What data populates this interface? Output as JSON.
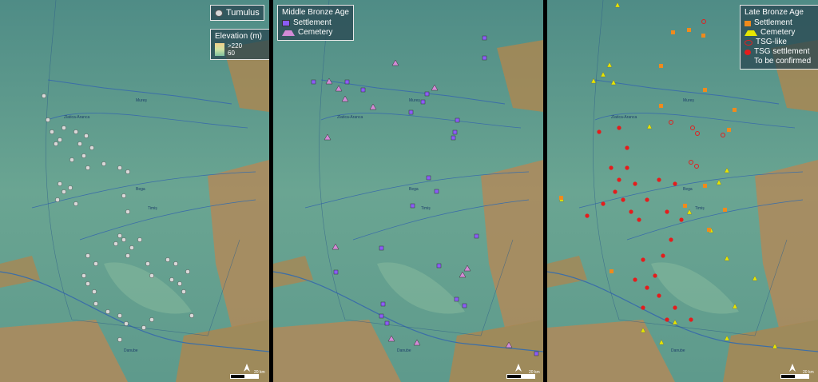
{
  "panels": [
    {
      "legend": {
        "title": "",
        "items": [
          {
            "label": "Tumulus",
            "symbol": "grey-circle"
          }
        ],
        "elevation_title": "Elevation (m)",
        "elevation_high": ">220",
        "elevation_low": "60"
      },
      "rivers": [
        "Mureș",
        "Zlatica-Aranca",
        "Bega",
        "Timiș",
        "Danube"
      ],
      "scale_label": "20 km"
    },
    {
      "legend": {
        "title": "Middle Bronze Age",
        "items": [
          {
            "label": "Settlement",
            "symbol": "purple-square"
          },
          {
            "label": "Cemetery",
            "symbol": "purple-triangle"
          }
        ]
      },
      "rivers": [
        "Mureș",
        "Zlatica-Aranca",
        "Bega",
        "Timiș",
        "Danube"
      ],
      "scale_label": "20 km"
    },
    {
      "legend": {
        "title": "Late Bronze Age",
        "items": [
          {
            "label": "Settlement",
            "symbol": "orange-square"
          },
          {
            "label": "Cemetery",
            "symbol": "yellow-triangle"
          },
          {
            "label": "TSG-like",
            "symbol": "red-ring"
          },
          {
            "label": "TSG settlement",
            "symbol": "red-dot"
          },
          {
            "label": "To be confirmed",
            "symbol": "none"
          }
        ]
      },
      "rivers": [
        "Mureș",
        "Zlatica-Aranca",
        "Bega",
        "Timiș",
        "Danube"
      ],
      "scale_label": "20 km"
    }
  ],
  "colors": {
    "tumulus": "#d8d8d8",
    "mba_settlement": "#8b5cf6",
    "mba_cemetery": "#d38bd6",
    "lba_settlement": "#f08a1c",
    "lba_cemetery": "#e6e600",
    "tsg": "#e51c1c",
    "river": "#3b6ea8",
    "lowland": "#6fa58f",
    "highland": "#b08a5a"
  },
  "icons": {
    "north": "north-arrow-icon"
  }
}
